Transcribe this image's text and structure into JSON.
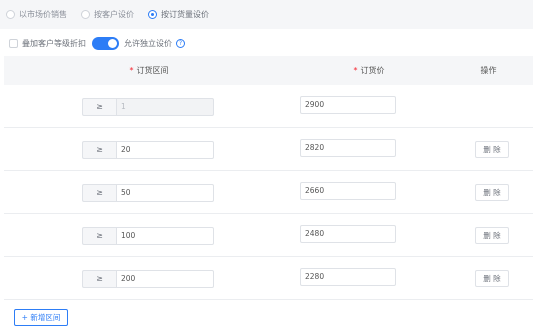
{
  "pricing_mode": {
    "options": [
      {
        "label": "以市场价销售",
        "checked": false
      },
      {
        "label": "按客户设价",
        "checked": false
      },
      {
        "label": "按订货量设价",
        "checked": true
      }
    ]
  },
  "options_row": {
    "stack_discount_label": "叠加客户等级折扣",
    "stack_discount_checked": false,
    "allow_independent_label": "允许独立设价",
    "allow_independent_on": true,
    "help_icon_glyph": "?"
  },
  "table": {
    "headers": {
      "range": "订货区间",
      "price": "订货价",
      "actions": "操作"
    },
    "required_mark": "*",
    "ge_symbol": "≥",
    "delete_label": "删 除",
    "rows": [
      {
        "min_qty": "1",
        "price": "2900",
        "disabled": true,
        "deletable": false
      },
      {
        "min_qty": "20",
        "price": "2820",
        "disabled": false,
        "deletable": true
      },
      {
        "min_qty": "50",
        "price": "2660",
        "disabled": false,
        "deletable": true
      },
      {
        "min_qty": "100",
        "price": "2480",
        "disabled": false,
        "deletable": true
      },
      {
        "min_qty": "200",
        "price": "2280",
        "disabled": false,
        "deletable": true
      }
    ]
  },
  "add_range_label": "+ 新增区间",
  "colors": {
    "accent": "#2d7df6",
    "required": "#f5222d",
    "header_bg": "#f5f6f8"
  }
}
